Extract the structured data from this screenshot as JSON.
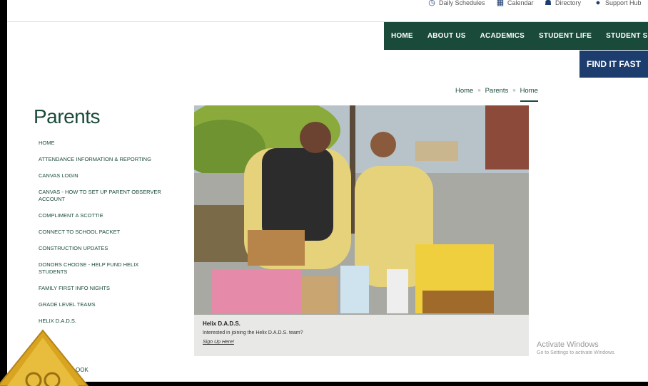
{
  "utility": {
    "schedules": "Daily Schedules",
    "calendar": "Calendar",
    "directory": "Directory",
    "support": "Support Hub"
  },
  "nav": {
    "items": [
      "HOME",
      "ABOUT US",
      "ACADEMICS",
      "STUDENT LIFE",
      "STUDENT SUPPORT"
    ]
  },
  "find_button": "FIND IT FAST",
  "breadcrumb": {
    "home": "Home",
    "parents": "Parents",
    "current": "Home"
  },
  "page_title": "Parents",
  "sidebar": {
    "items": [
      "HOME",
      "ATTENDANCE INFORMATION & REPORTING",
      "CANVAS LOGIN",
      "CANVAS - HOW TO SET UP PARENT OBSERVER ACCOUNT",
      "COMPLIMENT A SCOTTIE",
      "CONNECT TO SCHOOL PACKET",
      "CONSTRUCTION UPDATES",
      "DONORS CHOOSE - HELP FUND HELIX STUDENTS",
      "FAMILY FIRST INFO NIGHTS",
      "GRADE LEVEL TEAMS",
      "HELIX D.A.D.S."
    ]
  },
  "bottom_item": "OOK",
  "hero": {
    "caption_title": "Helix D.A.D.S.",
    "caption_text": "Interested in joining the Helix D.A.D.S. team?",
    "caption_link": "Sign Up Here!"
  },
  "watermark": {
    "title": "Activate Windows",
    "subtitle": "Go to Settings to activate Windows."
  },
  "colors": {
    "primary_green": "#1a4a3a",
    "navy": "#1c3d6e"
  }
}
